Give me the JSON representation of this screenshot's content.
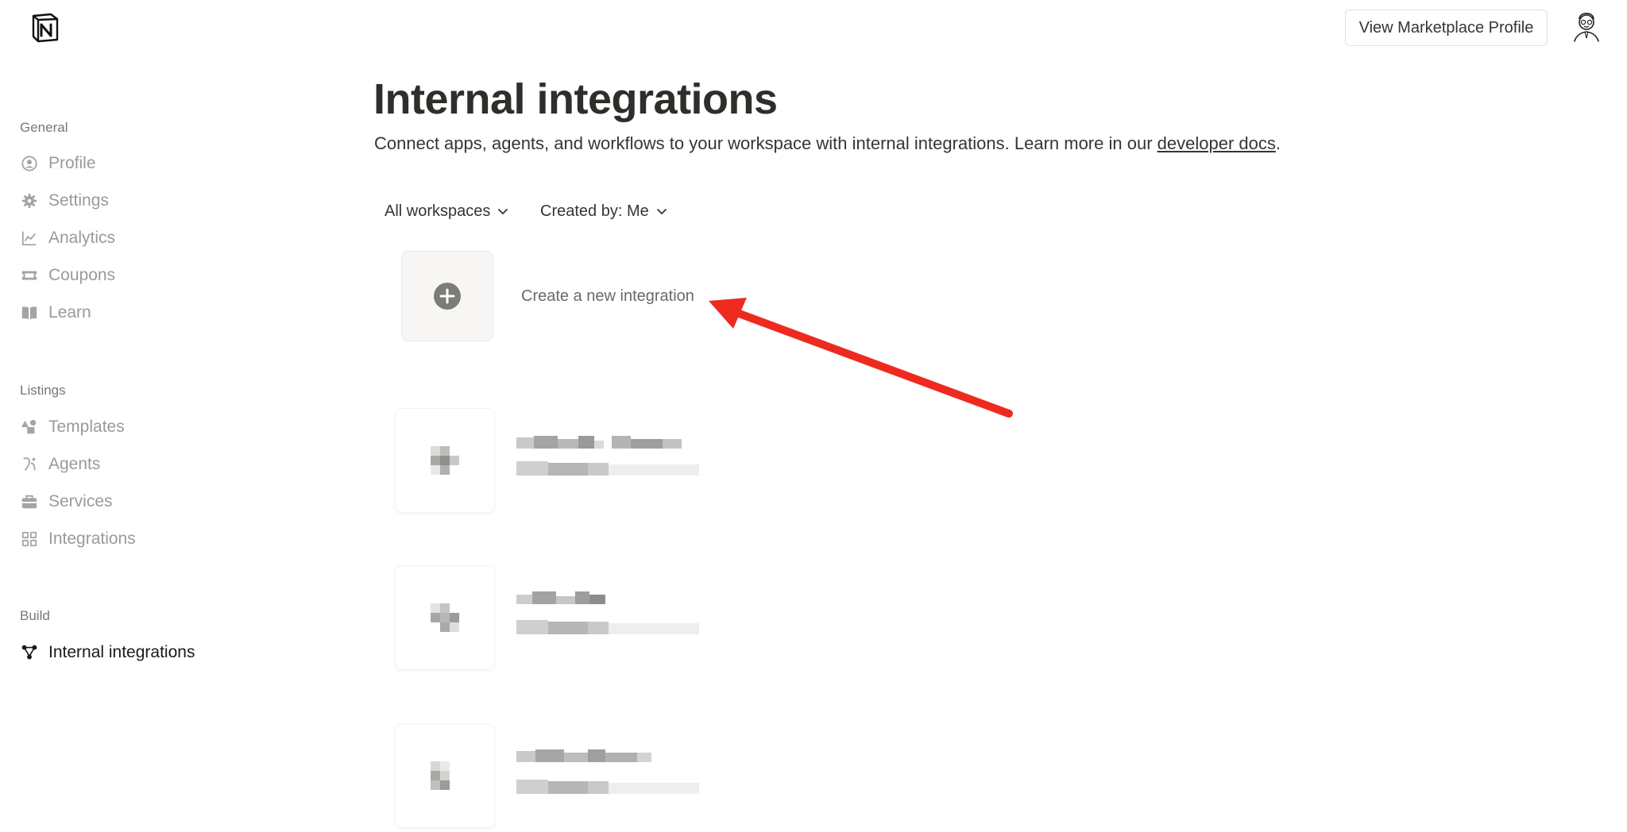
{
  "header": {
    "marketplace_button": "View Marketplace Profile"
  },
  "sidebar": {
    "sections": [
      {
        "label": "General",
        "items": [
          {
            "label": "Profile",
            "icon": "user-circle-icon"
          },
          {
            "label": "Settings",
            "icon": "gear-icon"
          },
          {
            "label": "Analytics",
            "icon": "line-chart-icon"
          },
          {
            "label": "Coupons",
            "icon": "ticket-icon"
          },
          {
            "label": "Learn",
            "icon": "book-icon"
          }
        ]
      },
      {
        "label": "Listings",
        "items": [
          {
            "label": "Templates",
            "icon": "shapes-icon"
          },
          {
            "label": "Agents",
            "icon": "agent-icon"
          },
          {
            "label": "Services",
            "icon": "briefcase-icon"
          },
          {
            "label": "Integrations",
            "icon": "grid-icon"
          }
        ]
      },
      {
        "label": "Build",
        "items": [
          {
            "label": "Internal integrations",
            "icon": "nodes-icon",
            "active": true
          }
        ]
      }
    ]
  },
  "main": {
    "title": "Internal integrations",
    "subtitle_prefix": "Connect apps, agents, and workflows to your workspace with internal integrations. Learn more in our ",
    "subtitle_link": "developer docs",
    "subtitle_suffix": ".",
    "filters": {
      "workspace": "All workspaces",
      "created_by": "Created by: Me"
    },
    "create_label": "Create a new integration"
  },
  "colors": {
    "annotation_arrow": "#ee2a1f",
    "text_primary": "#37352f",
    "text_muted": "#9b9a97"
  }
}
